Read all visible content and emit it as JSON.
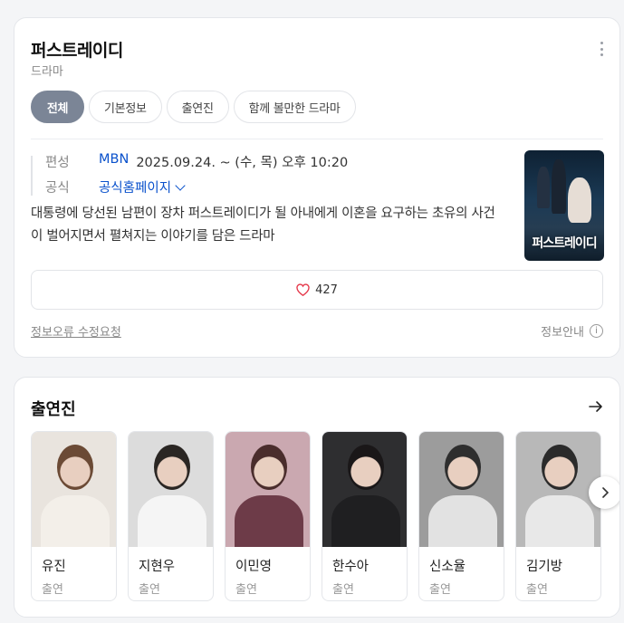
{
  "info": {
    "title": "퍼스트레이디",
    "subtitle": "드라마",
    "tabs": [
      {
        "label": "전체",
        "active": true
      },
      {
        "label": "기본정보",
        "active": false
      },
      {
        "label": "출연진",
        "active": false
      },
      {
        "label": "함께 볼만한 드라마",
        "active": false
      }
    ],
    "broadcast_label": "편성",
    "broadcast_channel": "MBN",
    "broadcast_schedule": "2025.09.24. ~  (수, 목) 오후 10:20",
    "official_label": "공식",
    "official_link": "공식홈페이지",
    "description": "대통령에 당선된 남편이 장차 퍼스트레이디가 될 아내에게 이혼을 요구하는 초유의 사건이 벌어지면서 펼쳐지는 이야기를 담은 드라마",
    "poster_text": "퍼스트레이디",
    "like_count": "427",
    "report_link": "정보오류 수정요청",
    "info_guide": "정보안내",
    "info_icon_glyph": "i",
    "colors": {
      "link": "#0b52cc",
      "active_tab": "#7b8596",
      "heart": "#e5384a"
    }
  },
  "cast": {
    "title": "출연진",
    "members": [
      {
        "name": "유진",
        "role": "출연",
        "bg": "#e9e4de",
        "hair": "#6b4a35",
        "cloth": "#f3efe9"
      },
      {
        "name": "지현우",
        "role": "출연",
        "bg": "#dcdcdc",
        "hair": "#2a2623",
        "cloth": "#f5f5f5"
      },
      {
        "name": "이민영",
        "role": "출연",
        "bg": "#caa8b0",
        "hair": "#4a2d2c",
        "cloth": "#6d3b48"
      },
      {
        "name": "한수아",
        "role": "출연",
        "bg": "#2e2e30",
        "hair": "#1a1718",
        "cloth": "#1f1f21"
      },
      {
        "name": "신소율",
        "role": "출연",
        "bg": "#9c9c9c",
        "hair": "#2e2e2e",
        "cloth": "#e2e2e2"
      },
      {
        "name": "김기방",
        "role": "출연",
        "bg": "#b8b8b8",
        "hair": "#2b2b2b",
        "cloth": "#e8e8e8"
      }
    ]
  }
}
